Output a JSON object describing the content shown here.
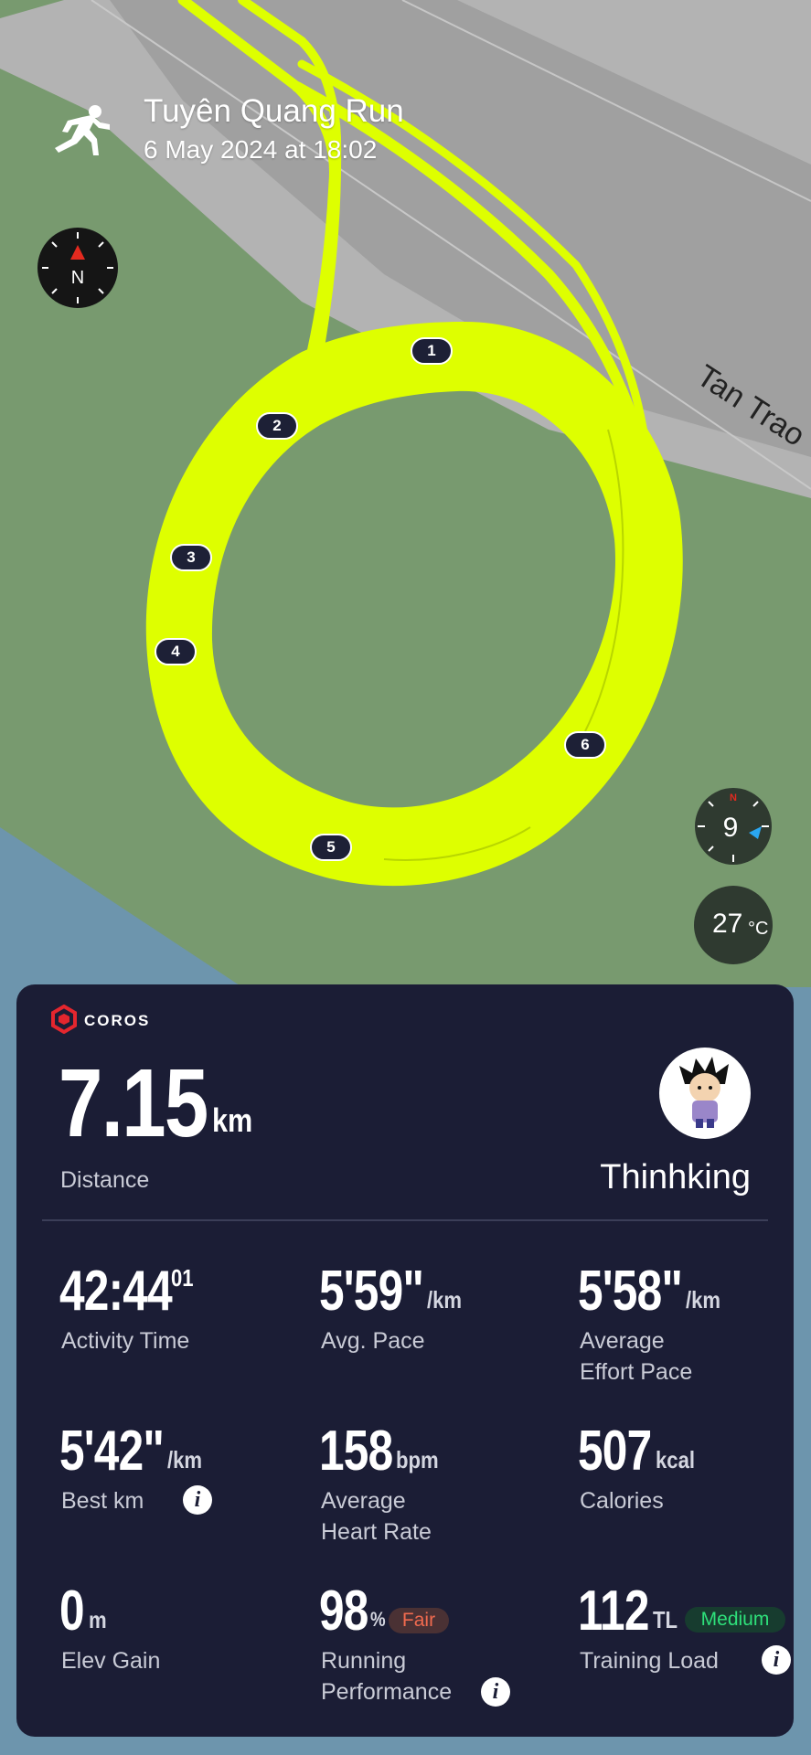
{
  "activity": {
    "title": "Tuyên Quang Run",
    "date": "6 May 2024 at 18:02",
    "icon": "running-person-icon"
  },
  "map": {
    "street_label": "Tan Trao",
    "compass_label": "N",
    "laps": [
      "1",
      "2",
      "3",
      "4",
      "5",
      "6"
    ],
    "track_color": "#deff00",
    "grass_color": "#789a6f",
    "road_color": "#b0b0b0",
    "water_color": "#6d95ad"
  },
  "weather": {
    "wind_speed": "9",
    "wind_compass_label": "N",
    "temperature": "27",
    "temperature_unit": "°C"
  },
  "card": {
    "brand": "COROS",
    "brand_color": "#e4262e",
    "distance": {
      "value": "7.15",
      "unit": "km",
      "label": "Distance"
    },
    "user": {
      "name": "Thinhking",
      "avatar": "avatar-cartoon"
    },
    "stats": {
      "activity_time": {
        "value": "42:44",
        "sup": "01",
        "label": "Activity Time"
      },
      "avg_pace": {
        "value": "5'59\"",
        "unit": "/km",
        "label": "Avg. Pace"
      },
      "effort_pace": {
        "value": "5'58\"",
        "unit": "/km",
        "label_line1": "Average",
        "label_line2": "Effort Pace"
      },
      "best_km": {
        "value": "5'42\"",
        "unit": "/km",
        "label": "Best km"
      },
      "heart_rate": {
        "value": "158",
        "unit": "bpm",
        "label_line1": "Average",
        "label_line2": "Heart Rate"
      },
      "calories": {
        "value": "507",
        "unit": "kcal",
        "label": "Calories"
      },
      "elev_gain": {
        "value": "0",
        "unit": "m",
        "label": "Elev Gain"
      },
      "running_performance": {
        "value": "98",
        "unit": "%",
        "badge": "Fair",
        "label_line1": "Running",
        "label_line2": "Performance"
      },
      "training_load": {
        "value": "112",
        "unit": "TL",
        "badge": "Medium",
        "label": "Training Load"
      }
    },
    "badge_colors": {
      "fair": "#f06a4f",
      "medium": "#2ee07a"
    }
  }
}
